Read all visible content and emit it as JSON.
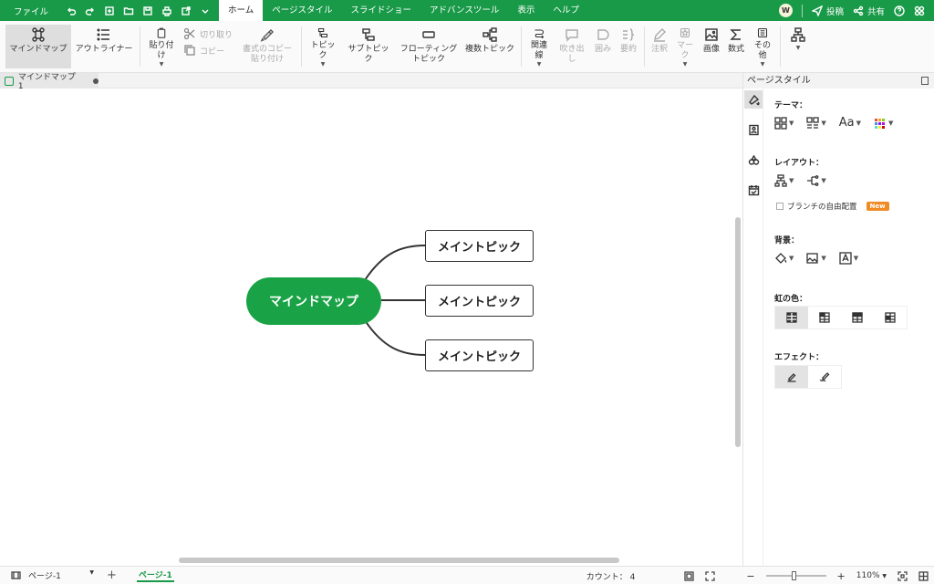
{
  "menubar": {
    "file": "ファイル",
    "items": [
      "ホーム",
      "ページスタイル",
      "スライドショー",
      "アドバンスツール",
      "表示",
      "ヘルプ"
    ],
    "avatar": "W",
    "post": "投稿",
    "share": "共有"
  },
  "ribbon": {
    "mindmap": "マインドマップ",
    "outliner": "アウトライナー",
    "paste": "貼り付け",
    "cut": "切り取り",
    "copy": "コピー",
    "format_copy_1": "書式のコピー",
    "format_copy_2": "貼り付け",
    "topic": "トピック",
    "subtopic": "サブトピック",
    "floating_1": "フローティング",
    "floating_2": "トピック",
    "multi_topic": "複数トピック",
    "relation": "関連線",
    "callout": "吹き出し",
    "boundary": "囲み",
    "summary": "要約",
    "note": "注釈",
    "mark": "マーク",
    "image": "画像",
    "formula": "数式",
    "other": "その他"
  },
  "doc_tab": {
    "name": "マインドマップ1"
  },
  "mindmap": {
    "central": "マインドマップ",
    "topics": [
      "メイントピック",
      "メイントピック",
      "メイントピック"
    ]
  },
  "panel": {
    "title": "ページスタイル",
    "theme": "テーマ：",
    "theme_font": "Aa",
    "layout": "レイアウト：",
    "free_branch": "ブランチの自由配置",
    "new_badge": "New",
    "background": "背景：",
    "rainbow": "虹の色：",
    "effect": "エフェクト："
  },
  "status": {
    "page_select": "ページ-1",
    "active_page": "ページ-1",
    "count_label": "カウント：",
    "count_value": "4",
    "zoom": "110%"
  },
  "colors": {
    "brand_green": "#189a48",
    "central_fill": "#1aa346",
    "badge_orange": "#f08a24"
  }
}
